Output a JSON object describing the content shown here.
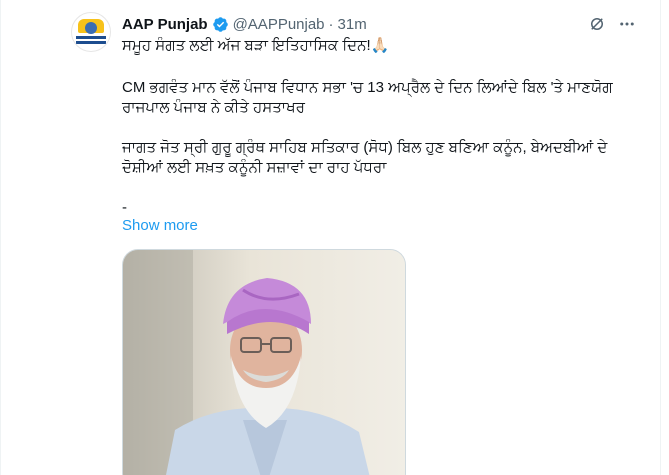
{
  "author": {
    "name": "AAP Punjab",
    "handle": "@AAPPunjab",
    "separator": "·",
    "time": "31m"
  },
  "tweet": {
    "line1": "ਸਮੂਹ ਸੰਗਤ ਲਈ ਅੱਜ ਬੜਾ ਇਤਿਹਾਸਿਕ ਦਿਨ!🙏🏻",
    "line2": "CM ਭਗਵੰਤ ਮਾਨ ਵੱਲੋਂ ਪੰਜਾਬ ਵਿਧਾਨ ਸਭਾ 'ਚ 13 ਅਪ੍ਰੈਲ ਦੇ ਦਿਨ ਲਿਆਂਦੇ ਬਿਲ 'ਤੇ ਮਾਣਯੋਗ ਰਾਜਪਾਲ ਪੰਜਾਬ ਨੇ ਕੀਤੇ ਹਸਤਾਖਰ",
    "line3": "ਜਾਗਤ ਜੋਤ ਸ੍ਰੀ ਗੁਰੂ ਗ੍ਰੰਥ ਸਾਹਿਬ ਸਤਿਕਾਰ (ਸੋਧ) ਬਿਲ ਹੁਣ ਬਣਿਆ ਕਨੂੰਨ, ਬੇਅਦਬੀਆਂ ਦੇ ਦੋਸ਼ੀਆਂ ਲਈ ਸਖ਼ਤ ਕਨੂੰਨੀ ਸਜ਼ਾਵਾਂ ਦਾ ਰਾਹ ਪੱਧਰਾ",
    "line4": "-",
    "show_more": "Show more"
  },
  "icons": {
    "verified": "verified-badge-icon",
    "grok": "grok-icon",
    "more": "more-options-icon"
  },
  "colors": {
    "accent": "#1d9bf0",
    "secondary_text": "#536471",
    "turban": "#c58ad9"
  }
}
